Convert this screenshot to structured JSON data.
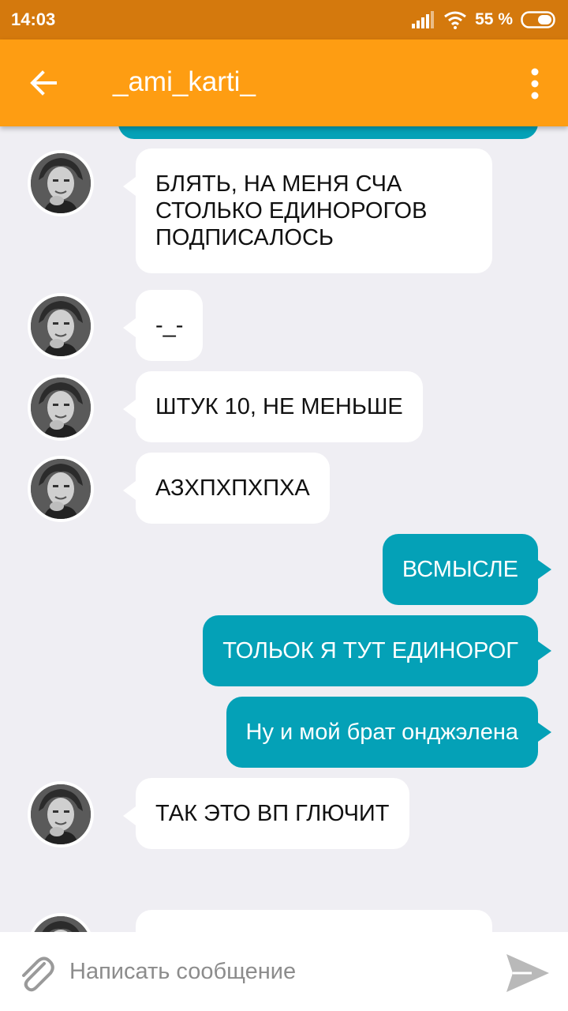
{
  "status_bar": {
    "time": "14:03",
    "battery_percent": "55 %"
  },
  "header": {
    "title": "_ami_karti_"
  },
  "messages": [
    {
      "from": "contact",
      "text": "БЛЯТЬ, НА МЕНЯ СЧА СТОЛЬКО ЕДИНОРОГОВ ПОДПИСАЛОСЬ"
    },
    {
      "from": "contact",
      "text": "-_-"
    },
    {
      "from": "contact",
      "text": "ШТУК 10, НЕ МЕНЬШЕ"
    },
    {
      "from": "contact",
      "text": "АЗХПХПХПХА"
    },
    {
      "from": "me",
      "text": "ВСМЫСЛЕ"
    },
    {
      "from": "me",
      "text": "ТОЛЬОК Я ТУТ ЕДИНОРОГ"
    },
    {
      "from": "me",
      "text": "Ну и мой брат онджэлена"
    },
    {
      "from": "contact",
      "text": "ТАК ЭТО ВП ГЛЮЧИТ"
    }
  ],
  "composer": {
    "placeholder": "Написать сообщение"
  },
  "colors": {
    "status_bar": "#d4790d",
    "app_bar": "#fe9d12",
    "outgoing_bubble": "#04a1b7",
    "incoming_bubble": "#ffffff",
    "chat_background": "#efeef3"
  },
  "icons": [
    "back-arrow-icon",
    "more-vert-icon",
    "signal-icon",
    "wifi-icon",
    "battery-icon",
    "paperclip-icon",
    "send-icon"
  ]
}
